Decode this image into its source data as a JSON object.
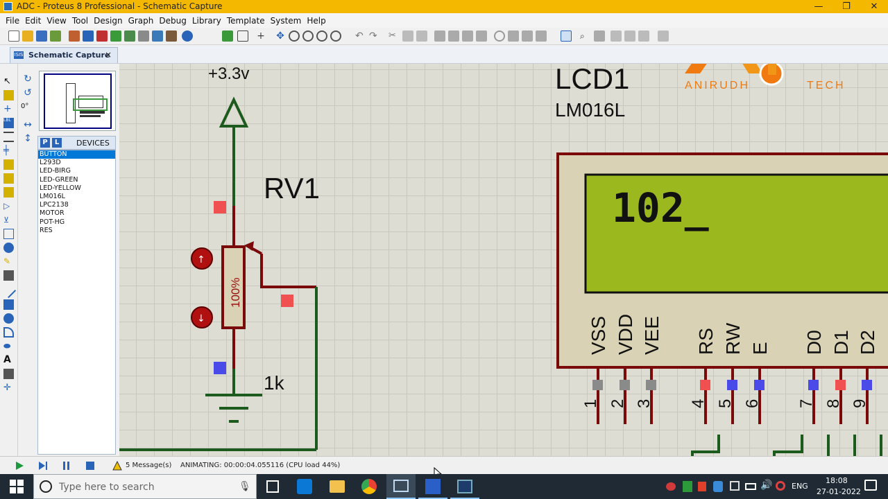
{
  "window": {
    "title": "ADC - Proteus 8 Professional - Schematic Capture",
    "min": "—",
    "max": "❐",
    "close": "✕"
  },
  "menu": [
    "File",
    "Edit",
    "View",
    "Tool",
    "Design",
    "Graph",
    "Debug",
    "Library",
    "Template",
    "System",
    "Help"
  ],
  "tab": {
    "icon": "ISIS",
    "label": "Schematic Capture",
    "close": "×"
  },
  "panel": {
    "rotation": "0°",
    "devices_header": "DEVICES",
    "p_btn": "P",
    "l_btn": "L"
  },
  "devices": [
    "BUTTON",
    "L293D",
    "LED-BIRG",
    "LED-GREEN",
    "LED-YELLOW",
    "LM016L",
    "LPC2138",
    "MOTOR",
    "POT-HG",
    "RES"
  ],
  "schematic": {
    "supply": "+3.3v",
    "pot_ref": "RV1",
    "pot_value": "1k",
    "pot_percent": "100%",
    "lcd_ref": "LCD1",
    "lcd_model": "LM016L",
    "lcd_display": "102_",
    "lcd_pins": [
      {
        "name": "VSS",
        "num": "1",
        "state": "gray"
      },
      {
        "name": "VDD",
        "num": "2",
        "state": "gray"
      },
      {
        "name": "VEE",
        "num": "3",
        "state": "gray"
      },
      {
        "name": "RS",
        "num": "4",
        "state": "red"
      },
      {
        "name": "RW",
        "num": "5",
        "state": "blue"
      },
      {
        "name": "E",
        "num": "6",
        "state": "blue"
      },
      {
        "name": "D0",
        "num": "7",
        "state": "blue"
      },
      {
        "name": "D1",
        "num": "8",
        "state": "red"
      },
      {
        "name": "D2",
        "num": "9",
        "state": "blue"
      }
    ]
  },
  "watermark": {
    "left": "ANIRUDH",
    "right": "TECH"
  },
  "status": {
    "messages": "5 Message(s)",
    "animating": "ANIMATING: 00:00:04.055116 (CPU load 44%)"
  },
  "taskbar": {
    "search_placeholder": "Type here to search",
    "lang": "ENG",
    "time": "18:08",
    "date": "27-01-2022"
  },
  "colors": {
    "title": "#f5b800",
    "wire": "#7a0a0a",
    "ground_wire": "#1d5a1d",
    "lcd_screen": "#9bb81f",
    "selected": "#0078d7"
  }
}
